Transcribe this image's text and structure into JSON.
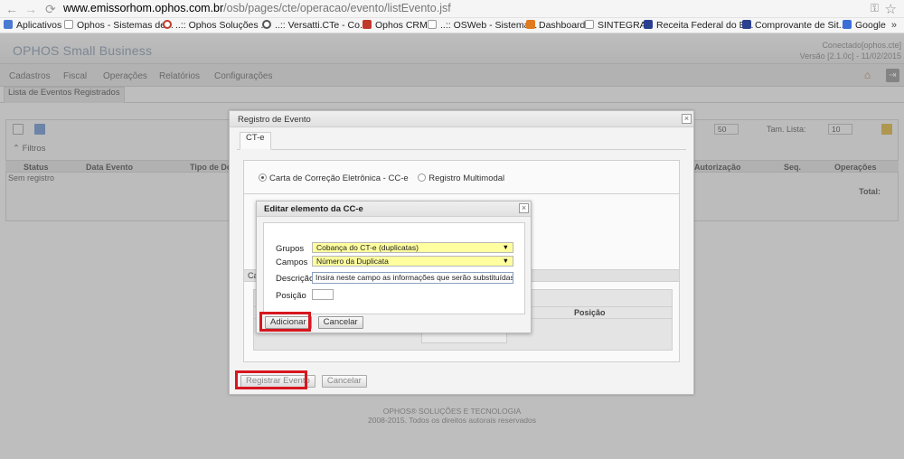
{
  "browser": {
    "url_domain": "www.emissorhom.ophos.com.br",
    "url_path": "/osb/pages/cte/operacao/evento/listEvento.jsf",
    "bookmarks": [
      {
        "label": "Aplicativos",
        "icon": "apps-grid-icon",
        "color": "#4a7bd0"
      },
      {
        "label": "Ophos - Sistemas de...",
        "icon": "page-icon",
        "color": "#ffffff"
      },
      {
        "label": "..:: Ophos Soluções ...",
        "icon": "circle-icon",
        "color": "#c0392b"
      },
      {
        "label": "..:: Versatti.CTe - Co...",
        "icon": "circle-icon",
        "color": "#555555"
      },
      {
        "label": "Ophos CRM",
        "icon": "cube-icon",
        "color": "#c0392b"
      },
      {
        "label": "..:: OSWeb - Sistema...",
        "icon": "page-icon",
        "color": "#ffffff"
      },
      {
        "label": "Dashboard",
        "icon": "dashboard-icon",
        "color": "#e07a1f"
      },
      {
        "label": "SINTEGRA",
        "icon": "page-icon",
        "color": "#ffffff"
      },
      {
        "label": "Receita Federal do B...",
        "icon": "flag-icon",
        "color": "#2a3f8f"
      },
      {
        "label": "Comprovante de Sit...",
        "icon": "flag-icon",
        "color": "#2a3f8f"
      },
      {
        "label": "Google",
        "icon": "google-icon",
        "color": "#3b6fd8"
      }
    ],
    "more": "»"
  },
  "app": {
    "logo": "OPHOS Small Business",
    "connected": "Conectado[ophos.cte]",
    "version": "Versão [2.1.0c] - 11/02/2015",
    "menu": [
      "Cadastros",
      "Fiscal",
      "Operações",
      "Relatórios",
      "Configurações"
    ],
    "page_tab": "Lista de Eventos Registrados",
    "filtros": "Filtros",
    "columns": [
      "Status",
      "Data Evento",
      "Tipo de Do",
      "Autorização",
      "Seq.",
      "Operações"
    ],
    "empty_text": "Sem registro",
    "total_label": "Total:",
    "page_size_label": "Tam. Lista:",
    "page_size_value": "10",
    "max_value": "50",
    "footer_line1": "OPHOS® SOLUÇÕES E TECNOLOGIA",
    "footer_line2": "2008-2015. Todos os direitos autorais reservados"
  },
  "registro_dialog": {
    "title": "Registro de Evento",
    "tab": "CT-e",
    "option_cce": "Carta de Correção Eletrônica - CC-e",
    "option_multimodal": "Registro Multimodal",
    "subsection": "Ca",
    "grid_header": "Posição",
    "btn_registrar": "Registrar Evento",
    "btn_cancelar": "Cancelar"
  },
  "editar_dialog": {
    "title": "Editar elemento da CC-e",
    "grupos_label": "Grupos",
    "grupos_value": "Cobança do CT-e (duplicatas)",
    "campos_label": "Campos",
    "campos_value": "Número da Duplicata",
    "descricao_label": "Descrição",
    "descricao_value": "Insira neste campo as informações que serão substituídas",
    "posicao_label": "Posição",
    "posicao_value": "",
    "btn_adicionar": "Adicionar",
    "btn_cancelar": "Cancelar"
  },
  "colors": {
    "highlight": "#d7161e",
    "select_bg": "#ffff9f"
  }
}
